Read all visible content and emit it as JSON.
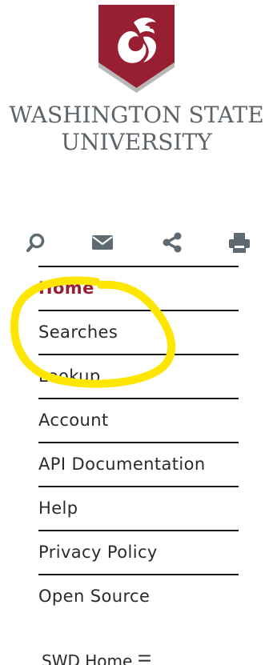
{
  "brand": {
    "name_line1": "WASHINGTON STATE",
    "name_line2": "UNIVERSITY",
    "shield_color": "#981e32",
    "wordmark_color": "#5d6469"
  },
  "toolbar": {
    "icons": [
      "search-icon",
      "mail-icon",
      "share-icon",
      "print-icon"
    ],
    "icon_color": "#5e6a71"
  },
  "nav": {
    "items": [
      {
        "label": "Home",
        "active": true
      },
      {
        "label": "Searches",
        "active": false
      },
      {
        "label": "Lookup",
        "active": false
      },
      {
        "label": "Account",
        "active": false
      },
      {
        "label": "API Documentation",
        "active": false
      },
      {
        "label": "Help",
        "active": false
      },
      {
        "label": "Privacy Policy",
        "active": false
      },
      {
        "label": "Open Source",
        "active": false
      }
    ],
    "active_color": "#981e32"
  },
  "annotation": {
    "color": "#ffe600",
    "encircled_items": [
      "Home",
      "Searches",
      "Lookup"
    ]
  },
  "footer": {
    "partial_text": "SWD Home ☰"
  }
}
